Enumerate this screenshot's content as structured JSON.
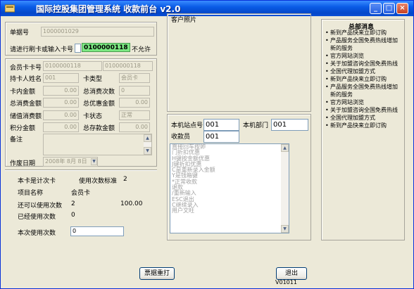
{
  "window": {
    "title": "国际控股集团管理系统 收款前台 v2.0",
    "controls": {
      "minimize": "_",
      "maximize": "□",
      "close": "×"
    }
  },
  "form": {
    "ticket_no_label": "单据号",
    "ticket_no_value": "1000001029",
    "swipe_label": "请进行刷卡或输入卡号",
    "swipe_small": "",
    "swipe_card_value": "0100000118",
    "swipe_status": "不允许",
    "member_card_label": "会员卡卡号",
    "member_card_value1": "0100000118",
    "member_card_value2": "0100000118",
    "holder_label": "持卡人姓名",
    "holder_value": "001",
    "card_type_label": "卡类型",
    "card_type_value": "会员卡",
    "balance_label": "卡内金额",
    "balance_value": "0.00",
    "total_consume_count_label": "总消费次数",
    "total_consume_count_value": "0",
    "total_consume_amount_label": "总消费金额",
    "total_consume_amount_value": "0.00",
    "total_discount_label": "总优惠金额",
    "total_discount_value": "0.00",
    "stored_consume_label": "储值消费额",
    "stored_consume_value": "0.00",
    "card_status_label": "卡状态",
    "card_status_value": "正常",
    "points_label": "积分金额",
    "points_value": "0.00",
    "total_deposit_label": "总存款金额",
    "total_deposit_value": "0.00",
    "remarks_label": "备注",
    "remarks_value": "",
    "op_date_label": "作废日期",
    "op_date_value": "2008年 8月 8日"
  },
  "count_card": {
    "is_count_card": "本卡是计次卡",
    "std_label": "使用次数标准",
    "std_value": "2",
    "item_name_label": "项目名称",
    "item_name_value": "会员卡",
    "remaining_label": "还可以使用次数",
    "remaining_value": "2",
    "remaining_amount": "100.00",
    "used_label": "已经使用次数",
    "used_value": "0",
    "this_use_label": "本次使用次数",
    "this_use_value": "0"
  },
  "customer": {
    "photo_label": "客户照片",
    "station_label": "本机站点号",
    "station_value": "001",
    "dept_label": "本机部门",
    "dept_value": "001",
    "cashier_label": "收款员",
    "cashier_value": "001"
  },
  "shortcuts": [
    "直接回车按卵",
    "门折扣优惠",
    "H键按金额优惠",
    "J键折扣优惠",
    "C是重新录入金额",
    "Y是钱箱键",
    "*正常收款",
    "退款",
    "/重新输入",
    "ESC退出",
    "C继续录入",
    "用户文旺"
  ],
  "news": {
    "title": "总部消息",
    "items": [
      "新到产品快来立即订购",
      "产品服务全国免费热线增加新的服务",
      "官方网站浏览",
      "关于加盟咨询全国免费热线",
      "全国代理加盟方式",
      "新到产品快来立即订购",
      "产品服务全国免费热线增加新的服务",
      "官方网站浏览",
      "关于加盟咨询全国免费热线",
      "全国代理加盟方式",
      "新到产品快来立即订购"
    ]
  },
  "buttons": {
    "reprint": "票据重打",
    "exit": "退出"
  },
  "status": {
    "version": "V01011"
  },
  "colors": {
    "title_bar": "#0A5BE6",
    "swipe_highlight": "#7BE882",
    "background": "#ECE9D8"
  }
}
